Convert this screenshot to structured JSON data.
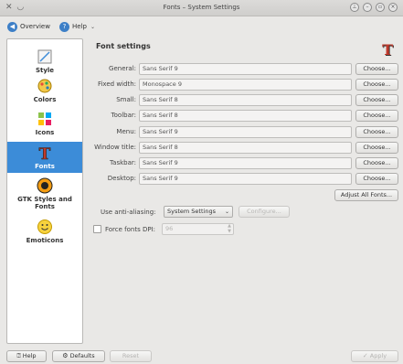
{
  "window": {
    "title": "Fonts – System Settings"
  },
  "toolbar": {
    "overview": "Overview",
    "help": "Help"
  },
  "sidebar": {
    "items": [
      {
        "label": "Style",
        "icon": "style-icon"
      },
      {
        "label": "Colors",
        "icon": "colors-icon"
      },
      {
        "label": "Icons",
        "icon": "icons-icon"
      },
      {
        "label": "Fonts",
        "icon": "fonts-icon",
        "selected": true
      },
      {
        "label": "GTK Styles and Fonts",
        "icon": "gtk-icon"
      },
      {
        "label": "Emoticons",
        "icon": "emoticons-icon"
      }
    ]
  },
  "main": {
    "heading": "Font settings",
    "choose_label": "Choose...",
    "fonts": [
      {
        "label": "General:",
        "value": "Sans Serif 9"
      },
      {
        "label": "Fixed width:",
        "value": "Monospace 9"
      },
      {
        "label": "Small:",
        "value": "Sans Serif 8"
      },
      {
        "label": "Toolbar:",
        "value": "Sans Serif 8"
      },
      {
        "label": "Menu:",
        "value": "Sans Serif 9"
      },
      {
        "label": "Window title:",
        "value": "Sans Serif 8"
      },
      {
        "label": "Taskbar:",
        "value": "Sans Serif 9"
      },
      {
        "label": "Desktop:",
        "value": "Sans Serif 9"
      }
    ],
    "adjust_all": "Adjust All Fonts...",
    "antialias_label": "Use anti-aliasing:",
    "antialias_value": "System Settings",
    "configure_label": "Configure...",
    "force_dpi_label": "Force fonts DPI:",
    "dpi_value": "96"
  },
  "bottom": {
    "help": "Help",
    "defaults": "Defaults",
    "reset": "Reset",
    "apply": "Apply"
  },
  "colors": {
    "selection": "#3c8cd8",
    "background": "#e9e8e6"
  }
}
